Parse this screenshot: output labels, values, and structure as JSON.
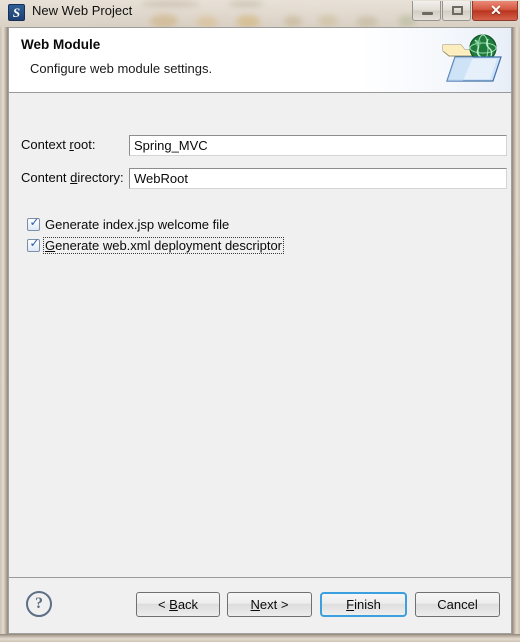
{
  "window": {
    "title": "New Web Project",
    "app_icon": "myeclipse-icon",
    "controls": {
      "minimize": "minimize-button",
      "maximize": "maximize-button",
      "close_label": "✕"
    }
  },
  "header": {
    "title": "Web Module",
    "description": "Configure web module settings.",
    "icon": "web-folder-globe-icon"
  },
  "form": {
    "fields": [
      {
        "label_before": "Context ",
        "label_mnemonic": "r",
        "label_after": "oot:",
        "value": "Spring_MVC",
        "name": "context-root"
      },
      {
        "label_before": "Content ",
        "label_mnemonic": "d",
        "label_after": "irectory:",
        "value": "WebRoot",
        "name": "content-directory"
      }
    ],
    "checkboxes": [
      {
        "label_before": "",
        "label_mnemonic": "",
        "label_after": "Generate index.jsp welcome file",
        "checked": true,
        "focused": false,
        "check_glyph": "✓",
        "name": "generate-index-jsp"
      },
      {
        "label_before": "",
        "label_mnemonic": "G",
        "label_after": "enerate web.xml deployment descriptor",
        "checked": true,
        "focused": true,
        "check_glyph": "✓",
        "name": "generate-web-xml"
      }
    ]
  },
  "footer": {
    "help_label": "?",
    "buttons": [
      {
        "before": "< ",
        "mnemonic": "B",
        "after": "ack",
        "name": "back-button",
        "default": false
      },
      {
        "before": "",
        "mnemonic": "N",
        "after": "ext >",
        "name": "next-button",
        "default": false
      },
      {
        "before": "",
        "mnemonic": "F",
        "after": "inish",
        "name": "finish-button",
        "default": true
      },
      {
        "before": "Cancel",
        "mnemonic": "",
        "after": "",
        "name": "cancel-button",
        "default": false
      }
    ]
  },
  "colors": {
    "accent": "#3c9fe0",
    "close": "#b8351f",
    "body": "#f0f0f0",
    "frame": "#cdc2b3"
  }
}
